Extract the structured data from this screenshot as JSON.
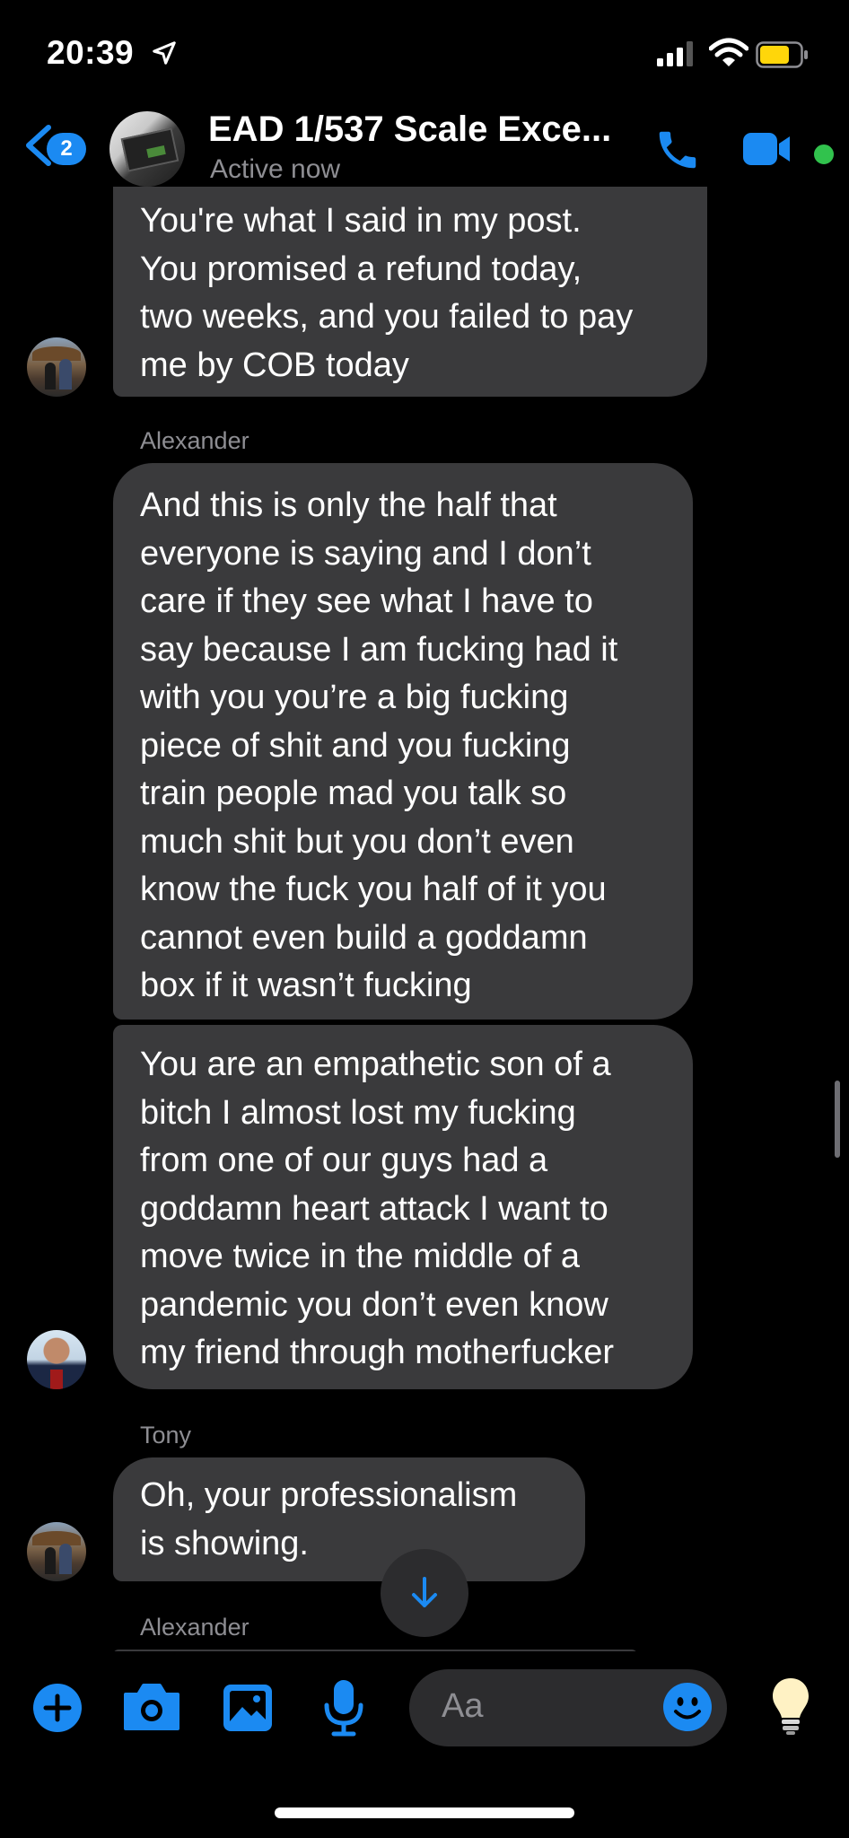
{
  "status_bar": {
    "time": "20:39"
  },
  "header": {
    "back_badge": "2",
    "title": "EAD 1/537  Scale Exce...",
    "subtitle": "Active now"
  },
  "messages": [
    {
      "lines": [
        "You're what I said in my post.",
        "You promised a refund today,",
        "two weeks, and you failed to pay",
        "me by COB today"
      ]
    },
    {
      "sender": "Alexander"
    },
    {
      "lines": [
        "And this is only the half that",
        "everyone is saying and I don’t",
        "care if they see what I have to",
        "say because I am fucking had it",
        "with you you’re a big fucking",
        "piece of shit and you fucking",
        "train people mad you talk so",
        "much shit but you don’t even",
        "know the fuck you half of it you",
        "cannot even build a goddamn",
        "box if it wasn’t fucking"
      ]
    },
    {
      "lines": [
        "You are an empathetic son of a",
        "bitch I almost lost my fucking",
        "from one of our guys had a",
        "goddamn heart attack I want to",
        "move twice in the middle of a",
        "pandemic you don’t even know",
        "my friend through motherfucker"
      ]
    },
    {
      "sender": "Tony"
    },
    {
      "lines": [
        "Oh, your professionalism",
        "is showing."
      ]
    },
    {
      "sender": "Alexander"
    }
  ],
  "composer": {
    "placeholder": "Aa"
  },
  "colors": {
    "accent": "#1b8af2",
    "bubble": "#3a3a3c",
    "online": "#31c24d"
  },
  "icons": [
    "location-arrow-icon",
    "signal-icon",
    "wifi-icon",
    "battery-icon",
    "back-chevron-icon",
    "phone-icon",
    "video-camera-icon",
    "arrow-down-icon",
    "plus-icon",
    "camera-icon",
    "image-icon",
    "microphone-icon",
    "emoji-icon",
    "lightbulb-icon"
  ]
}
